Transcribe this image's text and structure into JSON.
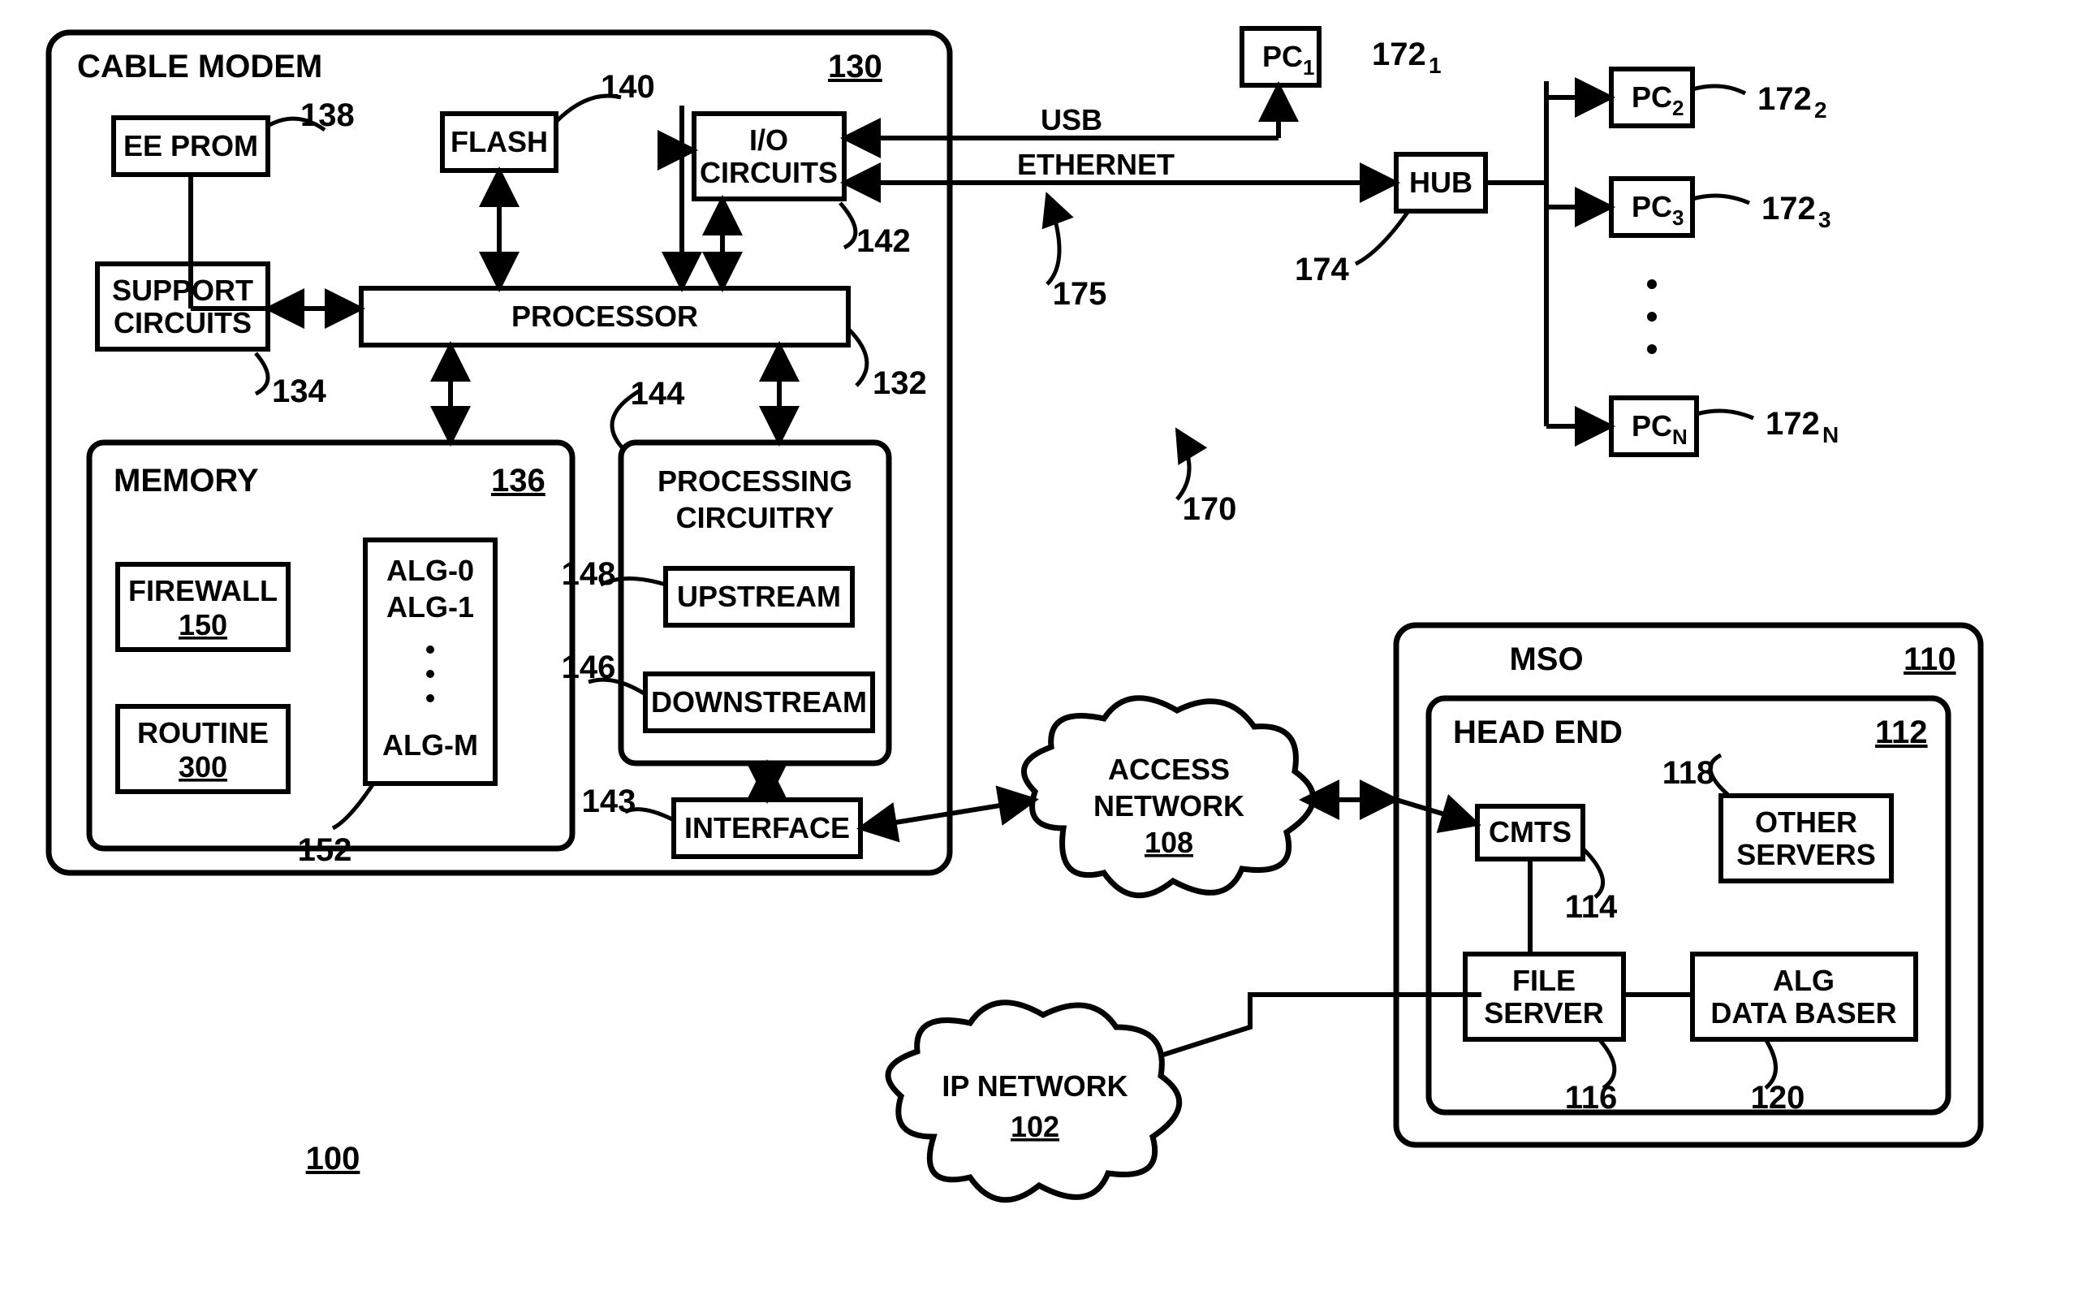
{
  "diagram_ref": "100",
  "cable_modem": {
    "title": "CABLE MODEM",
    "ref": "130",
    "eeprom": {
      "label": "EE PROM",
      "ref": "138"
    },
    "flash": {
      "label": "FLASH",
      "ref": "140"
    },
    "io": {
      "label": "I/O CIRCUITS",
      "ref": "142"
    },
    "support": {
      "label": "SUPPORT CIRCUITS",
      "ref": "134"
    },
    "processor": {
      "label": "PROCESSOR",
      "ref": "132"
    },
    "memory": {
      "title": "MEMORY",
      "ref": "136",
      "firewall": {
        "label": "FIREWALL",
        "ref": "150"
      },
      "routine": {
        "label": "ROUTINE",
        "ref": "300"
      },
      "algs": {
        "first": "ALG-0",
        "second": "ALG-1",
        "last": "ALG-M",
        "ref": "152"
      }
    },
    "processing": {
      "title": "PROCESSING CIRCUITRY",
      "ref": "144",
      "upstream": {
        "label": "UPSTREAM",
        "ref": "148"
      },
      "downstream": {
        "label": "DOWNSTREAM",
        "ref": "146"
      }
    },
    "interface": {
      "label": "INTERFACE",
      "ref": "143"
    }
  },
  "usb_label": "USB",
  "ethernet_label": "ETHERNET",
  "lan_ref": "175",
  "hub": {
    "label": "HUB",
    "ref": "174"
  },
  "pc1": {
    "label": "PC",
    "sub": "1",
    "ref": "172",
    "refsub": "1"
  },
  "pc2": {
    "label": "PC",
    "sub": "2",
    "ref": "172",
    "refsub": "2"
  },
  "pc3": {
    "label": "PC",
    "sub": "3",
    "ref": "172",
    "refsub": "3"
  },
  "pcN": {
    "label": "PC",
    "sub": "N",
    "ref": "172",
    "refsub": "N"
  },
  "env_ref": "170",
  "access_network": {
    "label1": "ACCESS",
    "label2": "NETWORK",
    "ref": "108"
  },
  "ip_network": {
    "label1": "IP NETWORK",
    "ref": "102"
  },
  "mso": {
    "title": "MSO",
    "ref": "110",
    "headend": {
      "title": "HEAD END",
      "ref": "112",
      "cmts": {
        "label": "CMTS",
        "ref": "114"
      },
      "other": {
        "label1": "OTHER",
        "label2": "SERVERS",
        "ref": "118"
      },
      "file": {
        "label1": "FILE",
        "label2": "SERVER",
        "ref": "116"
      },
      "algdb": {
        "label1": "ALG",
        "label2": "DATA BASER",
        "ref": "120"
      }
    }
  }
}
